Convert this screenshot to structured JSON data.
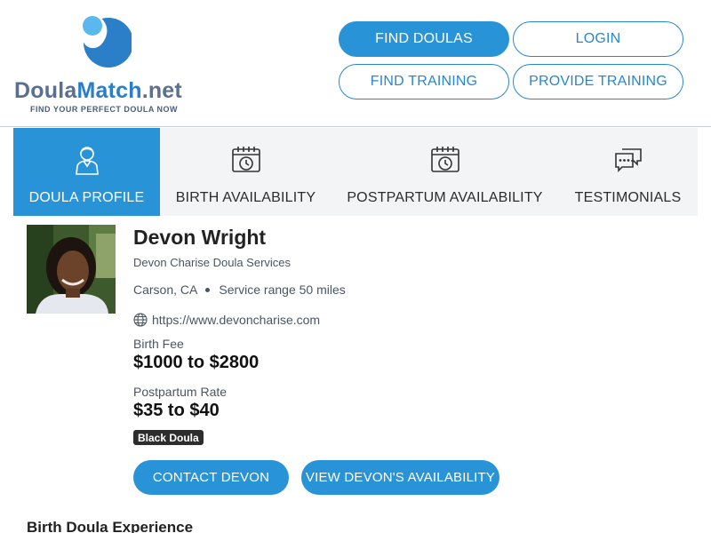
{
  "header": {
    "logo": {
      "brand_part1": "Doula",
      "brand_part2": "Match",
      "brand_part3": ".net",
      "tagline": "FIND YOUR PERFECT DOULA NOW"
    },
    "nav": {
      "find_doulas": "FIND DOULAS",
      "login": "LOGIN",
      "find_training": "FIND TRAINING",
      "provide_training": "PROVIDE TRAINING"
    }
  },
  "tabs": [
    {
      "label": "DOULA PROFILE",
      "icon": "doula-person-icon",
      "active": true
    },
    {
      "label": "BIRTH AVAILABILITY",
      "icon": "calendar-clock-icon",
      "active": false
    },
    {
      "label": "POSTPARTUM AVAILABILITY",
      "icon": "calendar-clock-icon",
      "active": false
    },
    {
      "label": "TESTIMONIALS",
      "icon": "chat-bubbles-icon",
      "active": false
    }
  ],
  "profile": {
    "name": "Devon Wright",
    "business": "Devon Charise Doula Services",
    "city": "Carson, CA",
    "service_range": "Service range 50 miles",
    "website": "https://www.devoncharise.com",
    "birth_fee_label": "Birth Fee",
    "birth_fee_value": "$1000 to $2800",
    "postpartum_label": "Postpartum Rate",
    "postpartum_value": "$35 to $40",
    "badge": "Black Doula",
    "contact_button": "CONTACT DEVON",
    "availability_button": "VIEW DEVON'S AVAILABILITY"
  },
  "section": {
    "title": "Birth Doula Experience"
  },
  "colors": {
    "accent": "#2993d8",
    "tab_bg": "#f3f4f5",
    "logo_light": "#5bb8ee",
    "logo_dark": "#2b7fc8"
  }
}
